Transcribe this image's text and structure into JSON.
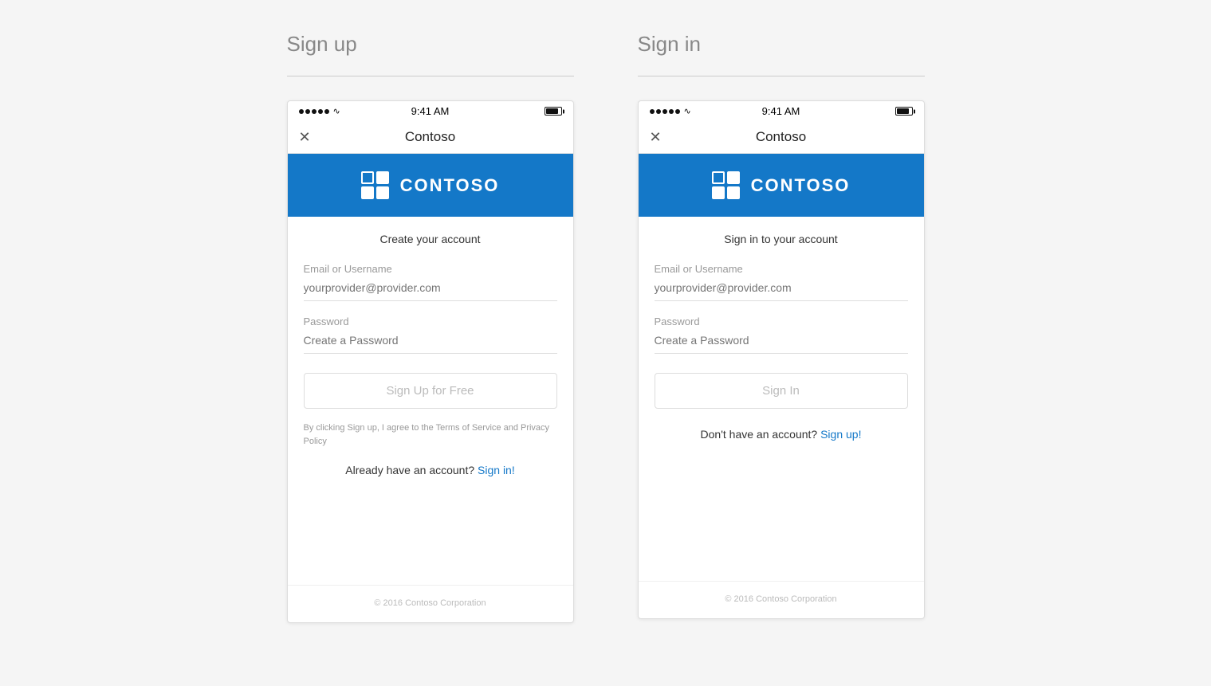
{
  "signup": {
    "section_title": "Sign up",
    "status": {
      "time": "9:41 AM"
    },
    "nav": {
      "title": "Contoso"
    },
    "brand": {
      "name": "CONTOSO"
    },
    "form": {
      "subtitle": "Create your account",
      "email_label": "Email or Username",
      "email_placeholder": "yourprovider@provider.com",
      "password_label": "Password",
      "password_placeholder": "Create a Password",
      "button_label": "Sign Up for Free",
      "terms_text": "By clicking Sign up, I agree to the Terms of Service and Privacy Policy",
      "account_text": "Already have an account?",
      "account_link": "Sign in!"
    },
    "footer": "© 2016 Contoso Corporation"
  },
  "signin": {
    "section_title": "Sign in",
    "status": {
      "time": "9:41 AM"
    },
    "nav": {
      "title": "Contoso"
    },
    "brand": {
      "name": "CONTOSO"
    },
    "form": {
      "subtitle": "Sign in to your account",
      "email_label": "Email or Username",
      "email_placeholder": "yourprovider@provider.com",
      "password_label": "Password",
      "password_placeholder": "Create a Password",
      "button_label": "Sign In",
      "account_text": "Don't have an account?",
      "account_link": "Sign up!"
    },
    "footer": "© 2016 Contoso Corporation"
  }
}
